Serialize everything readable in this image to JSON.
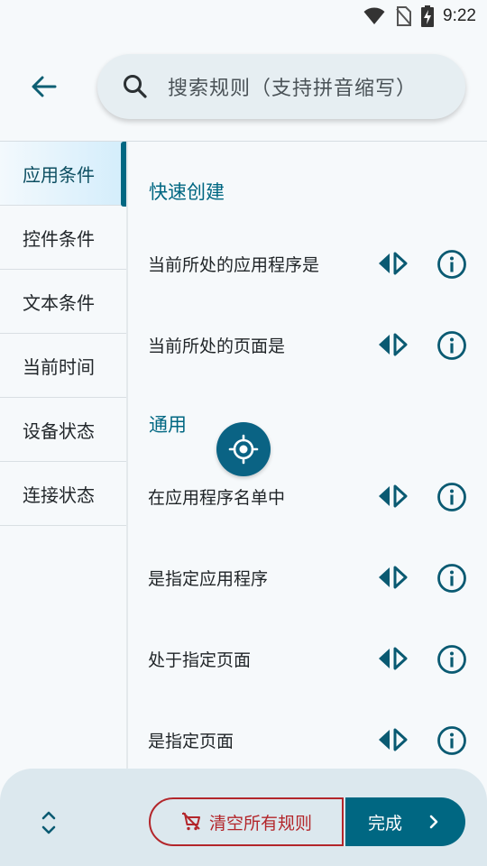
{
  "status_bar": {
    "time": "9:22",
    "icons": [
      "wifi-icon",
      "no-sim-icon",
      "battery-charging-icon"
    ]
  },
  "top_bar": {
    "back_icon": "arrow-left-icon",
    "search": {
      "icon": "search-icon",
      "placeholder": "搜索规则（支持拼音缩写）"
    }
  },
  "sidebar": {
    "items": [
      {
        "label": "应用条件",
        "active": true
      },
      {
        "label": "控件条件",
        "active": false
      },
      {
        "label": "文本条件",
        "active": false
      },
      {
        "label": "当前时间",
        "active": false
      },
      {
        "label": "设备状态",
        "active": false
      },
      {
        "label": "连接状态",
        "active": false
      }
    ]
  },
  "content": {
    "sections": [
      {
        "title": "快速创建",
        "rules": [
          "当前所处的应用程序是",
          "当前所处的页面是"
        ]
      },
      {
        "title": "通用",
        "rules": [
          "在应用程序名单中",
          "是指定应用程序",
          "处于指定页面",
          "是指定页面"
        ]
      }
    ],
    "row_icons": {
      "toggle": "left-right-arrows-icon",
      "info": "info-icon"
    }
  },
  "fab": {
    "icon": "crosshair-target-icon"
  },
  "bottom_bar": {
    "expand_icon": "unfold-icon",
    "clear_label": "清空所有规则",
    "clear_icon": "cart-remove-icon",
    "done_label": "完成",
    "done_icon": "chevron-right-icon"
  },
  "colors": {
    "accent": "#006782",
    "danger": "#b3262b",
    "active_bg": "#d3edfb"
  }
}
